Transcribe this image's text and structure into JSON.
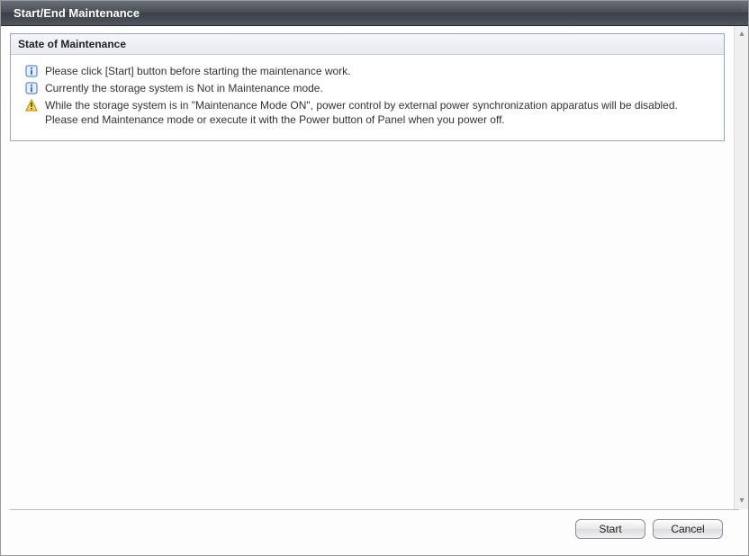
{
  "window": {
    "title": "Start/End Maintenance"
  },
  "panel": {
    "header": "State of Maintenance",
    "messages": [
      {
        "icon": "info",
        "text": "Please click [Start] button before starting the maintenance work."
      },
      {
        "icon": "info",
        "text": "Currently the storage system is Not in Maintenance mode."
      },
      {
        "icon": "warning",
        "text": "While the storage system is in \"Maintenance Mode ON\", power control by external power synchronization apparatus will be disabled. Please end Maintenance mode or execute it with the Power button of Panel when you power off."
      }
    ]
  },
  "buttons": {
    "start": "Start",
    "cancel": "Cancel"
  }
}
